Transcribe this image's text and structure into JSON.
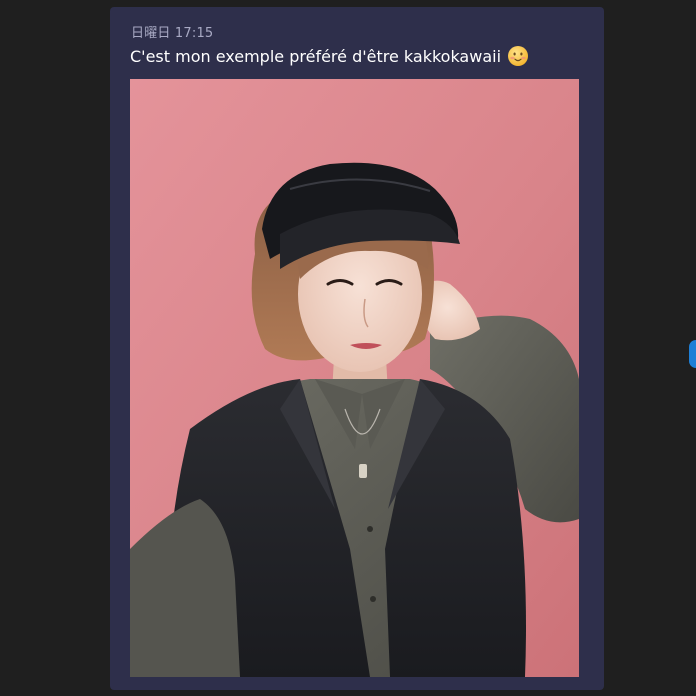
{
  "message": {
    "timestamp": "日曜日 17:15",
    "text": "C'est mon exemple préféré d'être kakkokawaii",
    "emoji": "smiling-face-icon"
  },
  "photo": {
    "subject": "photo-person-cap"
  },
  "colors": {
    "page_background": "#1f1f1f",
    "card_background": "#2e2f4b",
    "timestamp_text": "#a9aac4",
    "message_text": "#ffffff",
    "photo_wall": "#d9848a",
    "side_indicator": "#1e7fd6"
  }
}
